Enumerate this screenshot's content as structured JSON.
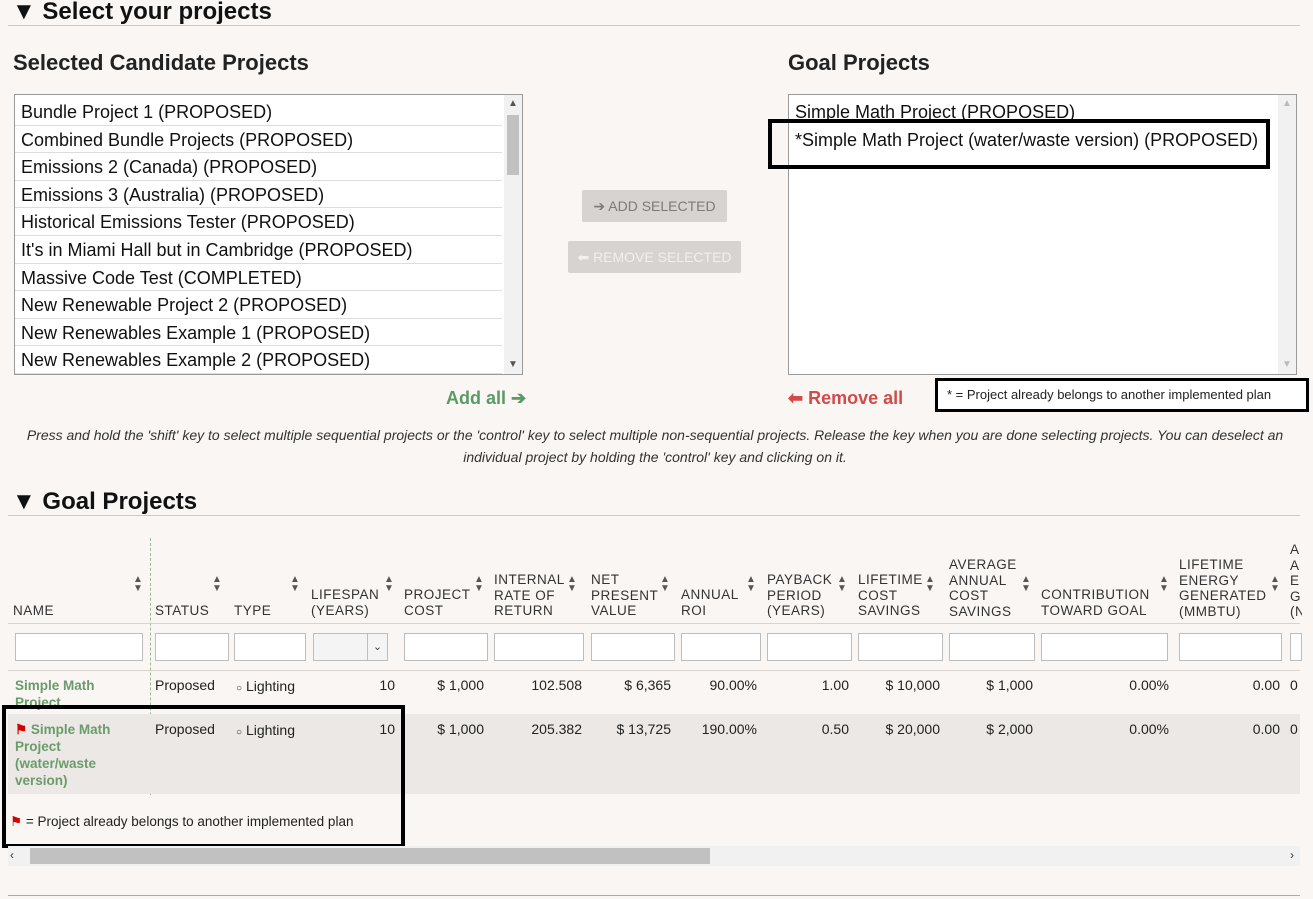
{
  "select_section": {
    "heading": "▼ Select your projects",
    "candidate_title": "Selected Candidate Projects",
    "goal_title": "Goal Projects",
    "candidates": [
      "Bundle Project 1 (PROPOSED)",
      "Combined Bundle Projects (PROPOSED)",
      "Emissions 2 (Canada) (PROPOSED)",
      "Emissions 3 (Australia) (PROPOSED)",
      "Historical Emissions Tester (PROPOSED)",
      "It's in Miami Hall but in Cambridge (PROPOSED)",
      "Massive Code Test (COMPLETED)",
      "New Renewable Project 2 (PROPOSED)",
      "New Renewables Example 1 (PROPOSED)",
      "New Renewables Example 2 (PROPOSED)"
    ],
    "goal_projects": [
      "Simple Math Project (PROPOSED)",
      "*Simple Math Project (water/waste version) (PROPOSED)"
    ],
    "add_selected_label": "ADD SELECTED",
    "remove_selected_label": "REMOVE SELECTED",
    "add_all_label": "Add all",
    "remove_all_label": "Remove all",
    "asterisk_legend": "* = Project already belongs to another implemented plan",
    "help_text_line1": "Press and hold the 'shift' key to select multiple sequential projects or the 'control' key to select multiple non-sequential projects. Release the key when you are done selecting projects. You can deselect an",
    "help_text_line2": "individual project by holding the 'control' key and clicking on it."
  },
  "goal_section": {
    "heading": "▼ Goal Projects",
    "columns": {
      "name": "NAME",
      "status": "STATUS",
      "type": "TYPE",
      "lifespan": "LIFESPAN (YEARS)",
      "project_cost": "PROJECT COST",
      "irr": "INTERNAL RATE OF RETURN",
      "npv": "NET PRESENT VALUE",
      "annual_roi": "ANNUAL ROI",
      "payback": "PAYBACK PERIOD (YEARS)",
      "lifetime_savings": "LIFETIME COST SAVINGS",
      "avg_savings": "AVERAGE ANNUAL COST SAVINGS",
      "contribution": "CONTRIBUTION TOWARD GOAL",
      "lifetime_energy": "LIFETIME ENERGY GENERATED (MMBTU)",
      "cut_col": "A A E G (N"
    },
    "rows": [
      {
        "name": "Simple Math Project",
        "flagged": false,
        "status": "Proposed",
        "type": "Lighting",
        "lifespan": "10",
        "project_cost": "$ 1,000",
        "irr": "102.508",
        "npv": "$ 6,365",
        "annual_roi": "90.00%",
        "payback": "1.00",
        "lifetime_savings": "$ 10,000",
        "avg_savings": "$ 1,000",
        "contribution": "0.00%",
        "lifetime_energy": "0.00",
        "cut": "0"
      },
      {
        "name": "Simple Math Project (water/waste version)",
        "flagged": true,
        "status": "Proposed",
        "type": "Lighting",
        "lifespan": "10",
        "project_cost": "$ 1,000",
        "irr": "205.382",
        "npv": "$ 13,725",
        "annual_roi": "190.00%",
        "payback": "0.50",
        "lifetime_savings": "$ 20,000",
        "avg_savings": "$ 2,000",
        "contribution": "0.00%",
        "lifetime_energy": "0.00",
        "cut": "0"
      }
    ],
    "flag_legend": "= Project already belongs to another implemented plan",
    "colors": {
      "flag": "#d40000",
      "link_green": "#6b9b6b",
      "remove_red": "#d34a4a"
    }
  }
}
